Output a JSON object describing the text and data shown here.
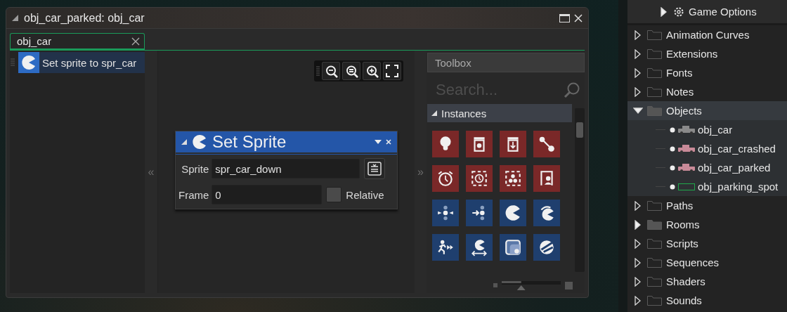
{
  "window": {
    "title": "obj_car_parked: obj_car"
  },
  "tabs": [
    {
      "label": "obj_car",
      "selected": true
    }
  ],
  "events": [
    {
      "label": "Set sprite to spr_car",
      "selected": true
    }
  ],
  "canvas": {
    "collapse_left": "«",
    "collapse_right": "»"
  },
  "action": {
    "title": "Set Sprite",
    "fields": [
      {
        "label": "Sprite",
        "value": "spr_car_down"
      },
      {
        "label": "Frame",
        "value": "0"
      }
    ],
    "relative": {
      "label": "Relative",
      "checked": false
    }
  },
  "toolbox": {
    "title": "Toolbox",
    "search": {
      "placeholder": "Search..."
    },
    "section": {
      "label": "Instances",
      "expanded": true
    },
    "zoom": {
      "level": 0.33
    },
    "tiles": [
      {
        "color": "#7a2828"
      },
      {
        "color": "#7a2828"
      },
      {
        "color": "#7a2828"
      },
      {
        "color": "#7a2828"
      },
      {
        "color": "#7a2828"
      },
      {
        "color": "#7a2828"
      },
      {
        "color": "#7a2828"
      },
      {
        "color": "#7a2828"
      },
      {
        "color": "#1f3f6e"
      },
      {
        "color": "#1f3f6e"
      },
      {
        "color": "#1f3f6e"
      },
      {
        "color": "#1f3f6e"
      },
      {
        "color": "#1f3f6e"
      },
      {
        "color": "#1f3f6e"
      },
      {
        "color": "#1f3f6e"
      },
      {
        "color": "#1f3f6e"
      }
    ]
  },
  "resources": {
    "options": [
      {
        "label": "Game Options",
        "expanded": false
      }
    ],
    "items": [
      {
        "label": "Animation Curves",
        "expanded": false,
        "empty": true
      },
      {
        "label": "Extensions",
        "expanded": false,
        "empty": true
      },
      {
        "label": "Fonts",
        "expanded": false,
        "empty": true
      },
      {
        "label": "Notes",
        "expanded": false,
        "empty": true
      },
      {
        "label": "Objects",
        "expanded": true,
        "empty": false,
        "children": [
          {
            "label": "obj_car",
            "kind": "car",
            "color": "#8a8a8a"
          },
          {
            "label": "obj_car_crashed",
            "kind": "car",
            "color": "#c88a98"
          },
          {
            "label": "obj_car_parked",
            "kind": "car",
            "color": "#c88a98"
          },
          {
            "label": "obj_parking_spot",
            "kind": "outline",
            "color": "#1fa84a"
          }
        ]
      },
      {
        "label": "Paths",
        "expanded": false,
        "empty": true
      },
      {
        "label": "Rooms",
        "expanded": false,
        "empty": false
      },
      {
        "label": "Scripts",
        "expanded": false,
        "empty": true
      },
      {
        "label": "Sequences",
        "expanded": false,
        "empty": true
      },
      {
        "label": "Shaders",
        "expanded": false,
        "empty": true
      },
      {
        "label": "Sounds",
        "expanded": false,
        "empty": true
      }
    ]
  }
}
